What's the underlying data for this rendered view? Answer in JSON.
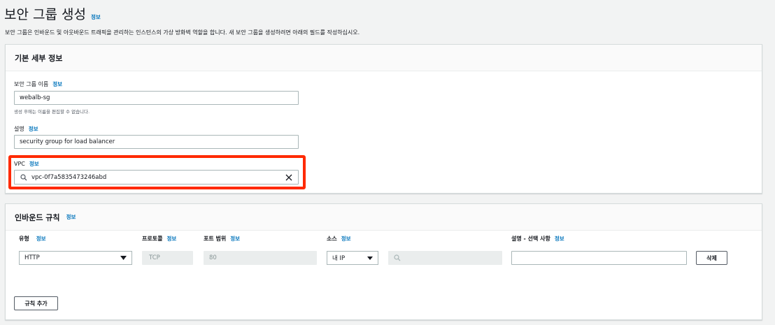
{
  "page": {
    "title": "보안 그룹 생성",
    "title_info": "정보",
    "description": "보안 그룹은 인바운드 및 아웃바운드 트래픽을 관리하는 인스턴스의 가상 방화벽 역할을 합니다. 새 보안 그룹을 생성하려면 아래의 필드를 작성하십시오."
  },
  "basic_details": {
    "header": "기본 세부 정보",
    "name_label": "보안 그룹 이름",
    "name_info": "정보",
    "name_value": "webalb-sg",
    "name_hint": "생성 후에는 이름을 편집할 수 없습니다.",
    "desc_label": "설명",
    "desc_info": "정보",
    "desc_value": "security group for load balancer",
    "vpc_label": "VPC",
    "vpc_info": "정보",
    "vpc_value": "vpc-0f7a5835473246abd"
  },
  "inbound": {
    "header": "인바운드 규칙",
    "header_info": "정보",
    "columns": {
      "type": "유형",
      "protocol": "프로토콜",
      "port_range": "포트 범위",
      "source": "소스",
      "description": "설명 - 선택 사항",
      "info": "정보"
    },
    "rule": {
      "type": "HTTP",
      "protocol": "TCP",
      "port": "80",
      "source": "내 IP",
      "description": "",
      "delete_label": "삭제"
    },
    "add_rule_label": "규칙 추가"
  },
  "colors": {
    "accent": "#0073bb",
    "highlight": "#ff2a00",
    "panel_header_bg": "#fafafa"
  },
  "icons": {
    "search": "search-icon",
    "clear": "close-icon",
    "dropdown": "caret-down-icon"
  }
}
